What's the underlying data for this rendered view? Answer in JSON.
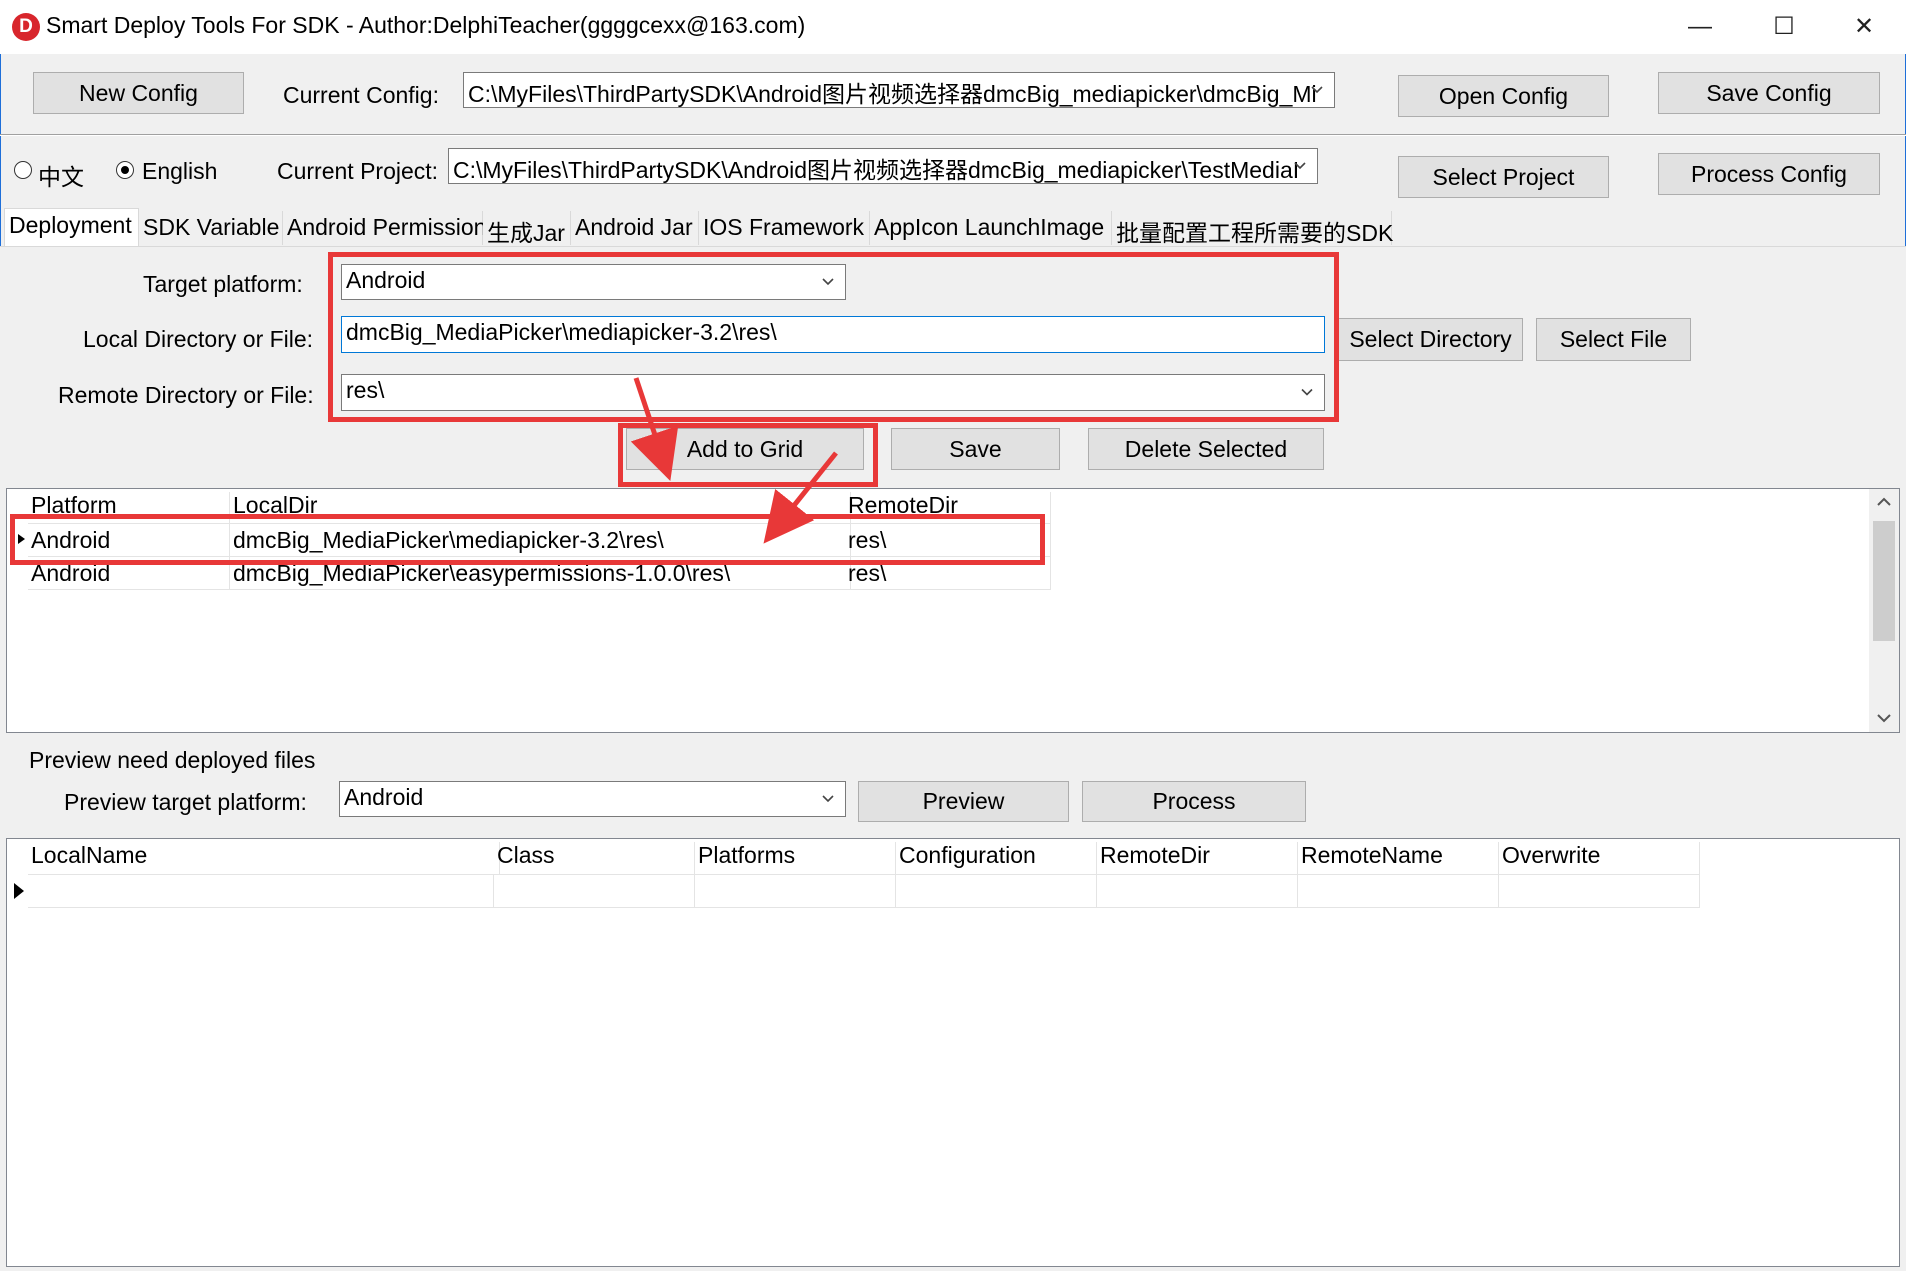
{
  "window": {
    "title": "Smart Deploy Tools For SDK - Author:DelphiTeacher(ggggcexx@163.com)",
    "logo": "D",
    "controls": {
      "minimize": "—",
      "maximize": "☐",
      "close": "✕"
    }
  },
  "toolbar": {
    "new_config": "New Config",
    "current_config_label": "Current Config:",
    "current_config_value": "C:\\MyFiles\\ThirdPartySDK\\Android图片视频选择器dmcBig_mediapicker\\dmcBig_Mi",
    "open_config": "Open Config",
    "save_config": "Save Config"
  },
  "language": {
    "chinese": "中文",
    "english": "English",
    "selected": "English"
  },
  "project": {
    "current_project_label": "Current Project:",
    "current_project_value": "C:\\MyFiles\\ThirdPartySDK\\Android图片视频选择器dmcBig_mediapicker\\TestMediaI",
    "select_project": "Select Project",
    "process_config": "Process Config"
  },
  "tabs": [
    {
      "label": "Deployment"
    },
    {
      "label": "SDK Variable"
    },
    {
      "label": "Android Permission"
    },
    {
      "label": "生成Jar"
    },
    {
      "label": "Android Jar"
    },
    {
      "label": "IOS Framework"
    },
    {
      "label": "AppIcon LaunchImage"
    },
    {
      "label": "批量配置工程所需要的SDK"
    }
  ],
  "deployment": {
    "target_platform_label": "Target platform:",
    "target_platform_value": "Android",
    "local_label": "Local Directory or File:",
    "local_value": "dmcBig_MediaPicker\\mediapicker-3.2\\res\\",
    "remote_label": "Remote Directory or File:",
    "remote_value": "res\\",
    "select_directory": "Select Directory",
    "select_file": "Select File",
    "add_to_grid": "Add to Grid",
    "save": "Save",
    "delete_selected": "Delete Selected"
  },
  "grid": {
    "columns": [
      "Platform",
      "LocalDir",
      "RemoteDir"
    ],
    "rows": [
      [
        "Android",
        "dmcBig_MediaPicker\\mediapicker-3.2\\res\\",
        "res\\"
      ],
      [
        "Android",
        "dmcBig_MediaPicker\\easypermissions-1.0.0\\res\\",
        "res\\"
      ]
    ]
  },
  "preview": {
    "heading": "Preview need deployed files",
    "platform_label": "Preview target platform:",
    "platform_value": "Android",
    "preview_button": "Preview",
    "process_button": "Process"
  },
  "files_grid": {
    "columns": [
      "LocalName",
      "Class",
      "Platforms",
      "Configuration",
      "RemoteDir",
      "RemoteName",
      "Overwrite"
    ]
  },
  "icons": {
    "dropdown": "chevron-down-icon",
    "row_indicator": "row-pointer-icon",
    "annotation": "red-arrow-icon"
  },
  "colors": {
    "annotation": "#e83838",
    "focus_border": "#0078d7",
    "button_face": "#e1e1e1"
  }
}
